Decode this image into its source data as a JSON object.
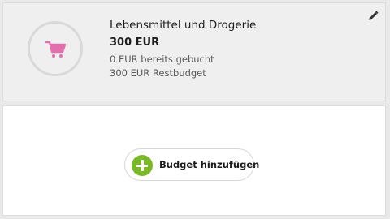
{
  "budget": {
    "category": "Lebensmittel und Drogerie",
    "amount": "300 EUR",
    "booked": "0 EUR bereits gebucht",
    "remaining": "300 EUR Restbudget",
    "icon": "shopping-cart-icon",
    "icon_color": "#e36fae"
  },
  "actions": {
    "edit_icon": "pencil-icon",
    "add_label": "Budget hinzufügen",
    "add_icon": "plus-circle-icon",
    "add_icon_color": "#7ab827"
  }
}
